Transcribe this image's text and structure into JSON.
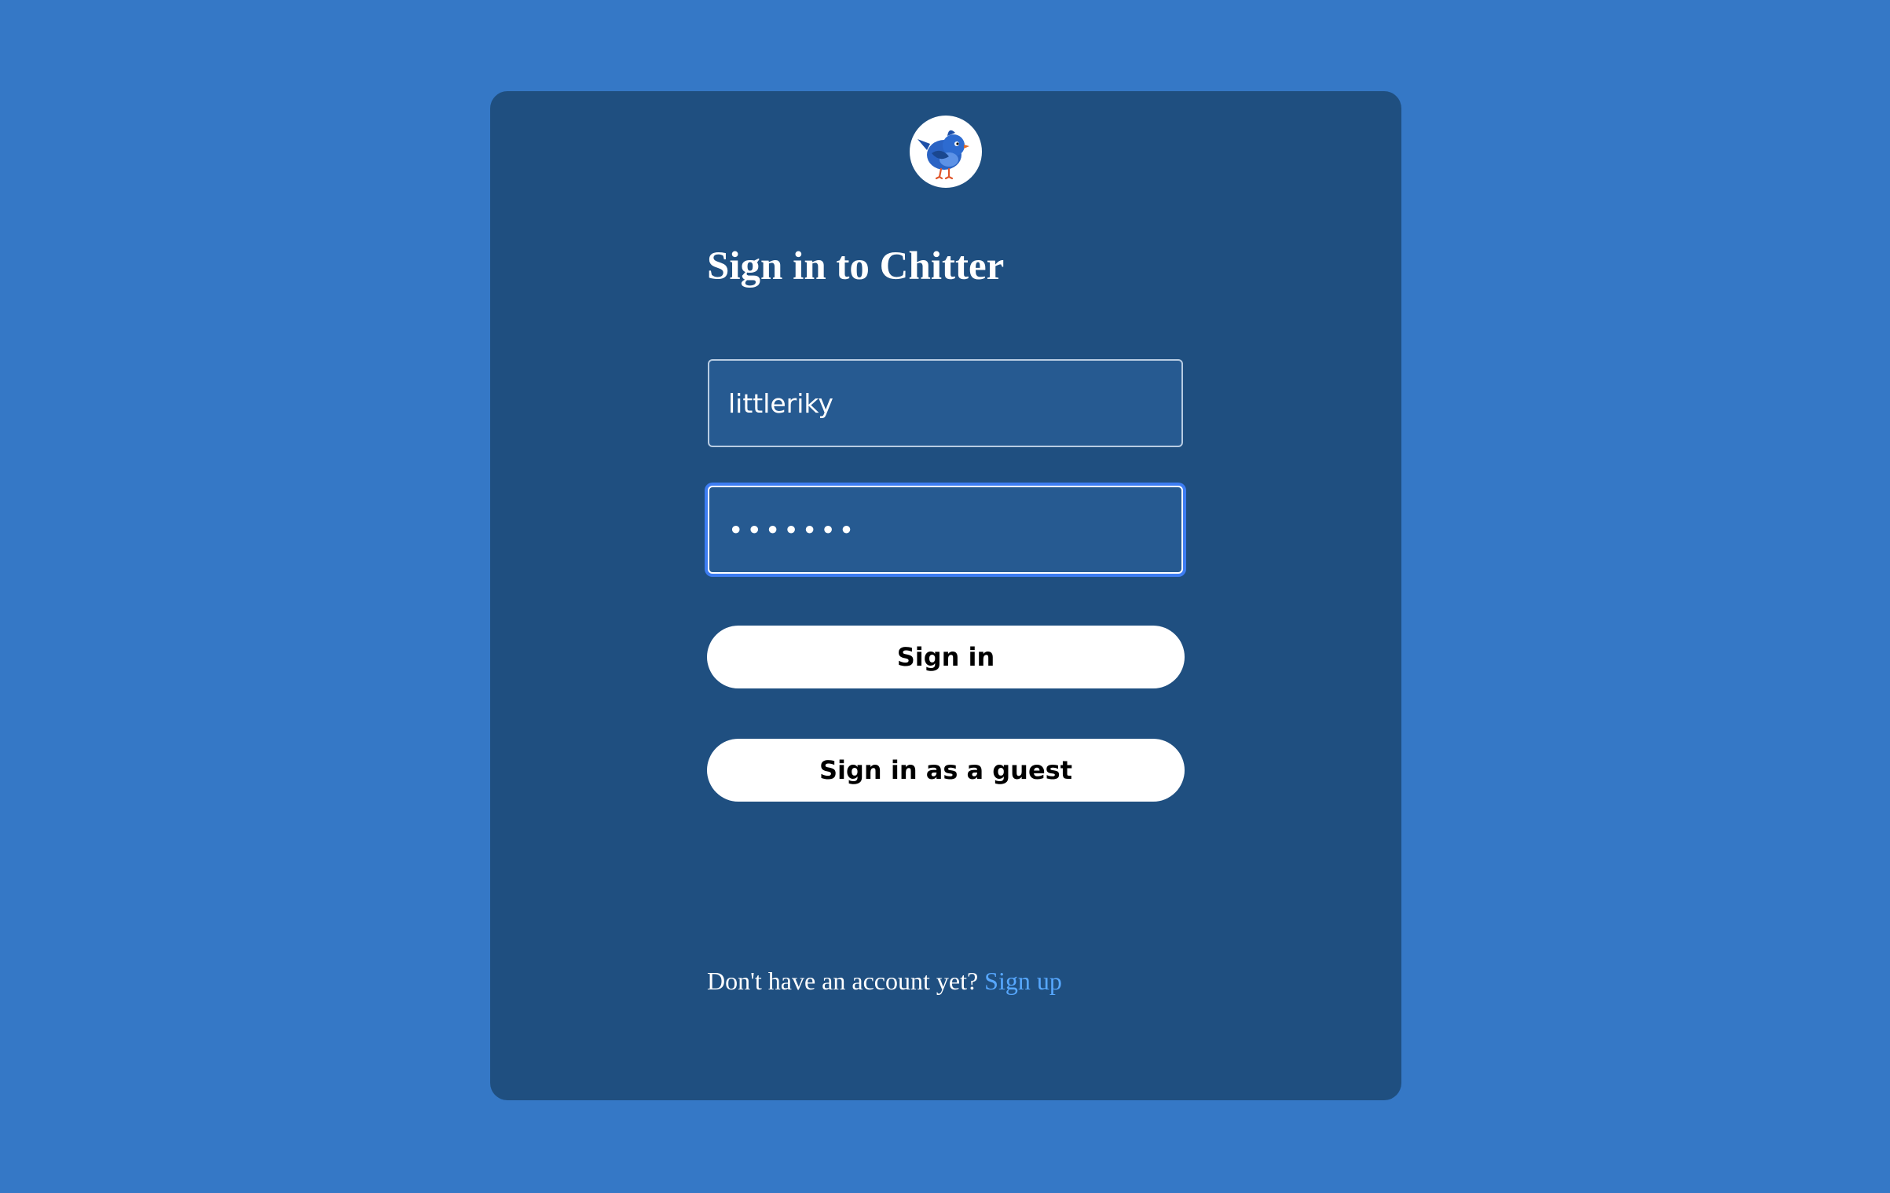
{
  "app": {
    "title": "Sign in to Chitter"
  },
  "logo": {
    "icon": "blue-bird-icon"
  },
  "form": {
    "username_value": "littleriky",
    "password_value": "•••••••",
    "signin_label": "Sign in",
    "guest_label": "Sign in as a guest"
  },
  "footer": {
    "prompt": "Don't have an account yet?",
    "signup_label": "Sign up"
  },
  "colors": {
    "page_background": "#3578c6",
    "card_background": "#1f4f80",
    "input_background": "#265a91",
    "focus_ring": "#3d7df2",
    "link": "#57a8ff"
  }
}
